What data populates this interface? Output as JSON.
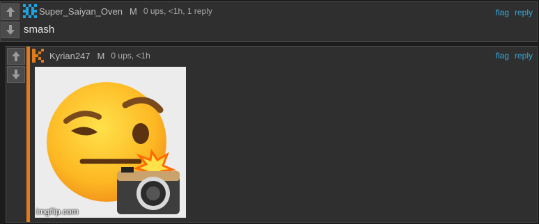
{
  "comments": [
    {
      "username": "Super_Saiyan_Oven",
      "mod_badge": "M",
      "meta": "0 ups, <1h, 1 reply",
      "actions": {
        "flag": "flag",
        "reply": "reply"
      },
      "text": "smash",
      "avatar_icon": "pixel-avatar-icon",
      "colors": {
        "avatar": "#1fa3e0"
      }
    },
    {
      "username": "Kyrian247",
      "mod_badge": "M",
      "meta": "0 ups, <1h",
      "actions": {
        "flag": "flag",
        "reply": "reply"
      },
      "image": {
        "emoji": "face-with-raised-eyebrow-with-camera-flash",
        "icon": "raised-eyebrow-emoji-image"
      },
      "avatar_icon": "k-letter-avatar-icon",
      "colors": {
        "avatar": "#e07a1a",
        "thread_stripe": "#e07a1a"
      }
    }
  ],
  "watermark": "imgflip.com",
  "colors": {
    "link": "#37a5d8",
    "background": "#1c1c1c",
    "panel": "#2f2f2f"
  }
}
